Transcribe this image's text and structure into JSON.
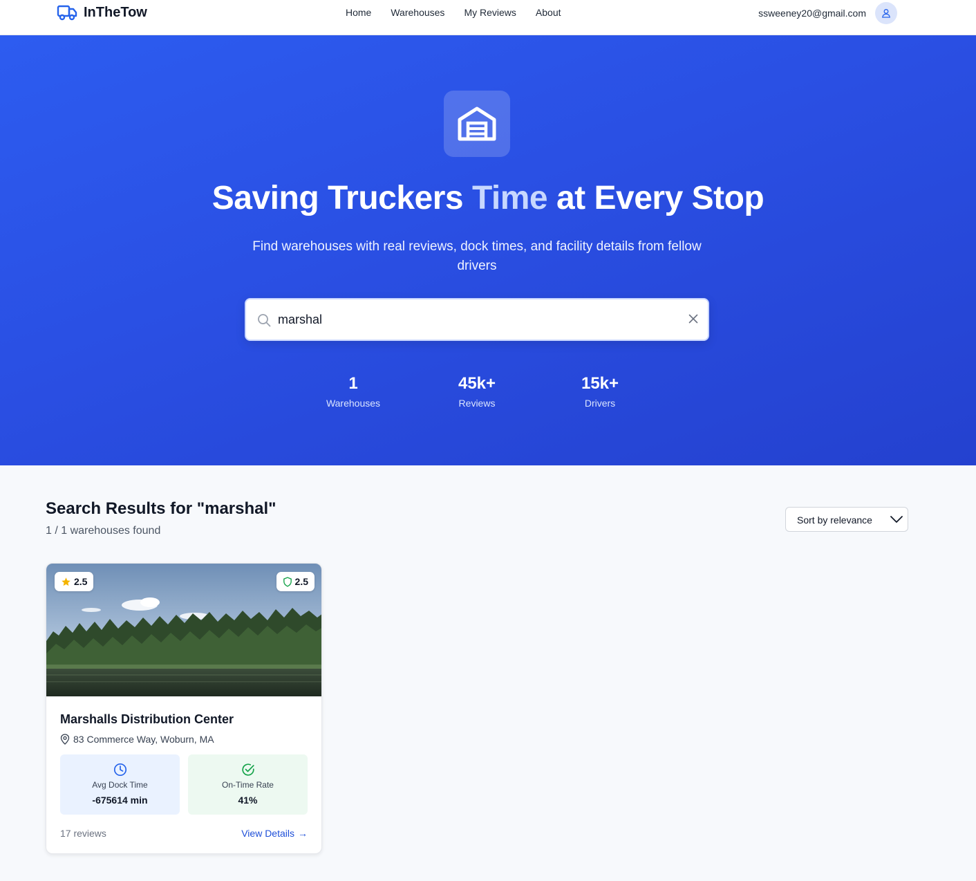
{
  "nav": {
    "brand": "InTheTow",
    "links": [
      "Home",
      "Warehouses",
      "My Reviews",
      "About"
    ],
    "user_email": "ssweeney20@gmail.com"
  },
  "hero": {
    "title_before": "Saving Truckers ",
    "title_accent": "Time",
    "title_after": " at Every Stop",
    "subtitle": "Find warehouses with real reviews, dock times, and facility details from fellow drivers",
    "search_value": "marshal",
    "stats": [
      {
        "value": "1",
        "label": "Warehouses"
      },
      {
        "value": "45k+",
        "label": "Reviews"
      },
      {
        "value": "15k+",
        "label": "Drivers"
      }
    ]
  },
  "results": {
    "title": "Search Results for \"marshal\"",
    "count": "1 / 1 warehouses found",
    "sort_label": "Sort by relevance"
  },
  "card": {
    "rating": "2.5",
    "safety": "2.5",
    "name": "Marshalls Distribution Center",
    "address": "83 Commerce Way, Woburn, MA",
    "dock_label": "Avg Dock Time",
    "dock_value": "-675614 min",
    "ontime_label": "On-Time Rate",
    "ontime_value": "41%",
    "reviews": "17 reviews",
    "link": "View Details",
    "link_arrow": "→"
  },
  "colors": {
    "primary": "#2a4fe3",
    "accent_text": "#c7d7fe",
    "link": "#1d4ed8",
    "star": "#f4b400",
    "shield": "#16a34a"
  }
}
